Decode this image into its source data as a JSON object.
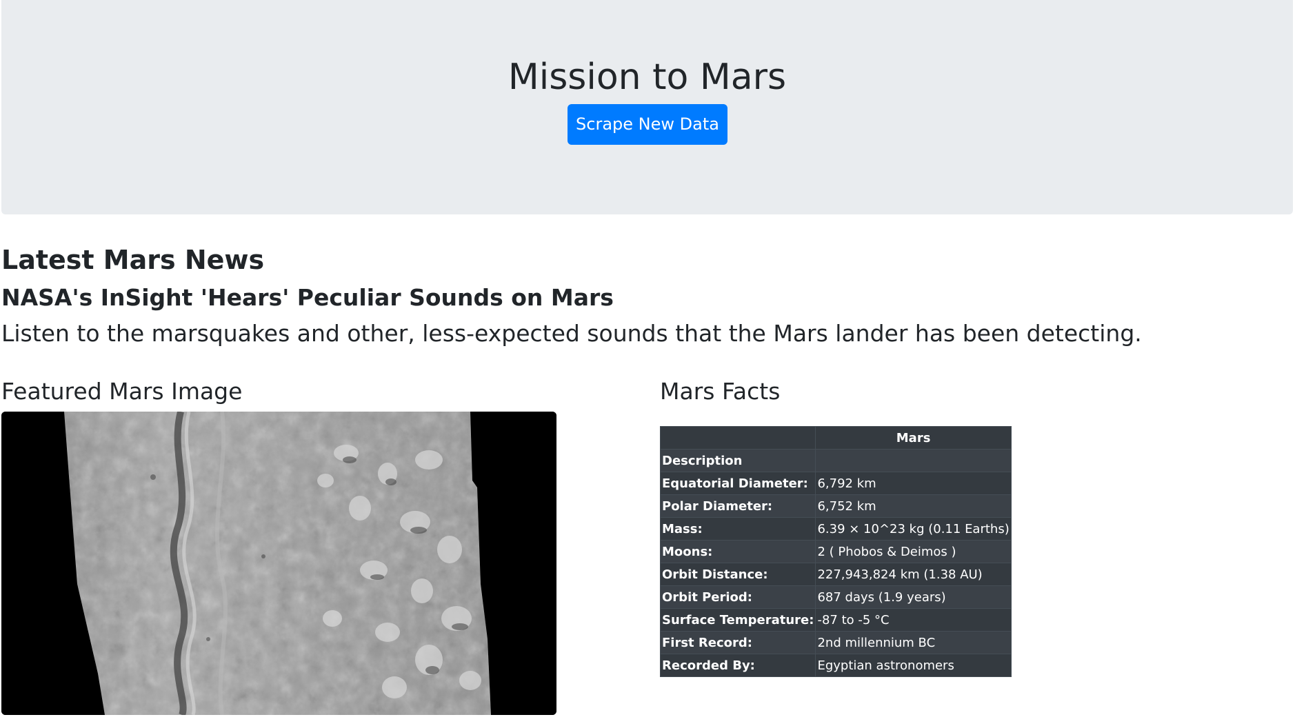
{
  "header": {
    "title": "Mission to Mars",
    "scrape_button_label": "Scrape New Data"
  },
  "news": {
    "section_heading": "Latest Mars News",
    "title": "NASA's InSight 'Hears' Peculiar Sounds on Mars",
    "teaser": "Listen to the marsquakes and other, less-expected sounds that the Mars lander has been detecting."
  },
  "featured": {
    "heading": "Featured Mars Image",
    "image": "mars-surface-grayscale-orbital-photo"
  },
  "facts": {
    "heading": "Mars Facts",
    "column_header": "Mars",
    "rows": [
      {
        "label": "Description",
        "value": ""
      },
      {
        "label": "Equatorial Diameter:",
        "value": "6,792 km"
      },
      {
        "label": "Polar Diameter:",
        "value": "6,752 km"
      },
      {
        "label": "Mass:",
        "value": "6.39 × 10^23 kg (0.11 Earths)"
      },
      {
        "label": "Moons:",
        "value": "2 ( Phobos & Deimos )"
      },
      {
        "label": "Orbit Distance:",
        "value": "227,943,824 km (1.38 AU)"
      },
      {
        "label": "Orbit Period:",
        "value": "687 days (1.9 years)"
      },
      {
        "label": "Surface Temperature:",
        "value": "-87 to -5 °C"
      },
      {
        "label": "First Record:",
        "value": "2nd millennium BC"
      },
      {
        "label": "Recorded By:",
        "value": "Egyptian astronomers"
      }
    ]
  },
  "colors": {
    "jumbotron_bg": "#e9ecef",
    "primary_button": "#007bff",
    "table_dark": "#343a40"
  }
}
